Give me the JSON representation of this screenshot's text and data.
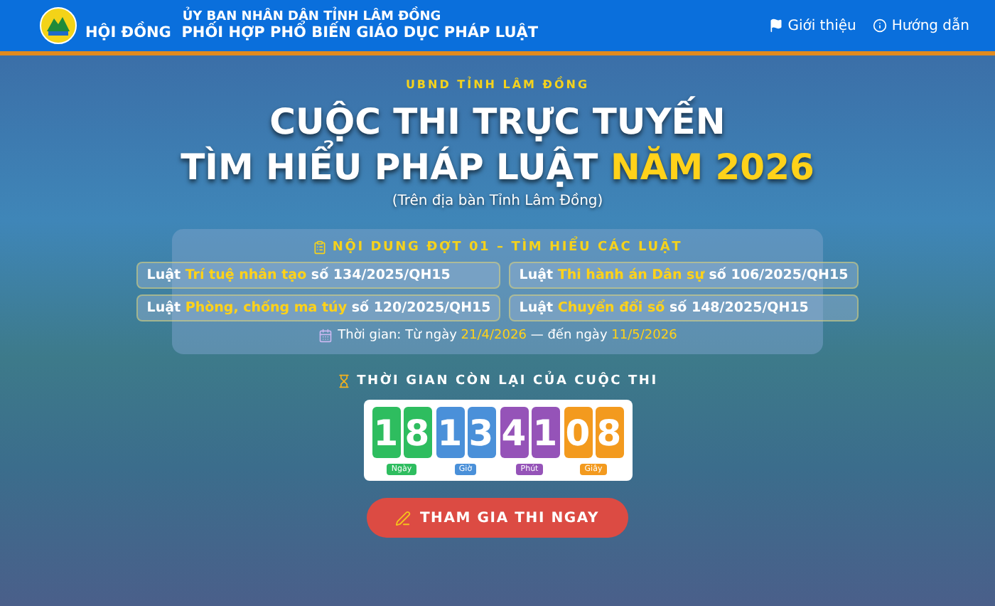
{
  "header": {
    "org_line_1": "ỦY BAN NHÂN DÂN TỈNH LÂM ĐỒNG",
    "org_line_2": "HỘI ĐỒNG  PHỐI HỢP PHỔ BIẾN GIÁO DỤC PHÁP LUẬT",
    "nav": [
      "Giới thiệu",
      "Hướng dẫn"
    ]
  },
  "hero": {
    "kicker": "UBND TỈNH LÂM ĐỒNG",
    "title_line_1": "CUỘC THI TRỰC TUYẾN",
    "title_line_2": "TÌM HIỂU PHÁP LUẬT",
    "title_highlight": "NĂM 2026",
    "subtitle": "(Trên địa bàn Tỉnh Lâm Đồng)"
  },
  "content_panel": {
    "heading": "NỘI DUNG ĐỢT 01 – TÌM HIỂU CÁC LUẬT",
    "laws": [
      {
        "prefix": "Luật",
        "name": "Trí tuệ nhân tạo",
        "number": "số 134/2025/QH15"
      },
      {
        "prefix": "Luật",
        "name": "Thi hành án Dân sự",
        "number": "số 106/2025/QH15"
      },
      {
        "prefix": "Luật",
        "name": "Phòng, chống ma túy",
        "number": "số 120/2025/QH15"
      },
      {
        "prefix": "Luật",
        "name": "Chuyển đổi số",
        "number": "số 148/2025/QH15"
      }
    ],
    "time": {
      "label": "Thời gian:",
      "from": "Từ ngày",
      "start": "21/4/2026",
      "dash": "—",
      "to": "đến ngày",
      "end": "11/5/2026"
    }
  },
  "countdown": {
    "heading": "THỜI GIAN CÒN LẠI CỦA CUỘC THI",
    "units": [
      {
        "digits": [
          "1",
          "8"
        ],
        "label": "Ngày",
        "color": "#2ebd5f"
      },
      {
        "digits": [
          "1",
          "3"
        ],
        "label": "Giờ",
        "color": "#4a90d9"
      },
      {
        "digits": [
          "4",
          "1"
        ],
        "label": "Phút",
        "color": "#9553b8"
      },
      {
        "digits": [
          "0",
          "8"
        ],
        "label": "Giây",
        "color": "#f39a1e"
      }
    ]
  },
  "cta_button": "THAM GIA THI NGAY"
}
